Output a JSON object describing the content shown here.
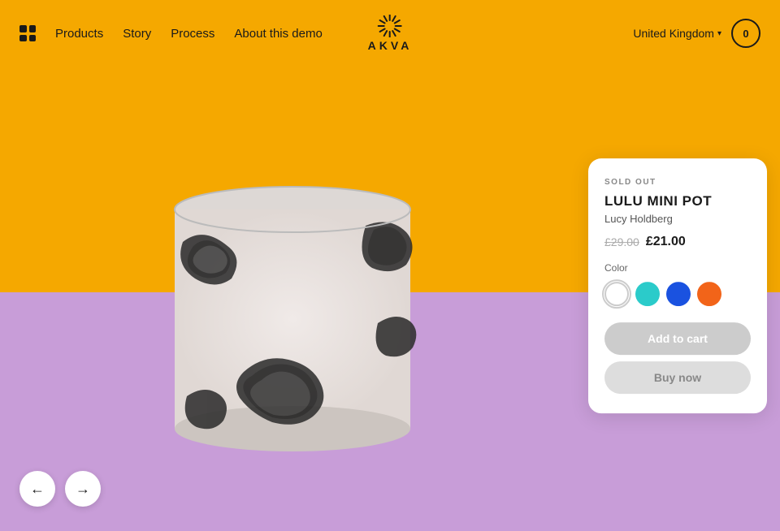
{
  "nav": {
    "products_label": "Products",
    "story_label": "Story",
    "process_label": "Process",
    "about_label": "About this demo",
    "logo_text": "AKVA",
    "region_label": "United Kingdom",
    "cart_count": "0"
  },
  "hero": {
    "top_color": "#F5A800",
    "bottom_color": "#C89DD8"
  },
  "product": {
    "sold_out_label": "SOLD OUT",
    "name": "LULU MINI POT",
    "artist": "Lucy Holdberg",
    "price_old": "£29.00",
    "price_new": "£21.00",
    "color_label": "Color",
    "colors": [
      {
        "name": "white",
        "hex": "#FFFFFF",
        "selected": true
      },
      {
        "name": "teal",
        "hex": "#2BCBCA",
        "selected": false
      },
      {
        "name": "blue",
        "hex": "#1A52E0",
        "selected": false
      },
      {
        "name": "orange",
        "hex": "#F26419",
        "selected": false
      }
    ],
    "add_to_cart_label": "Add to cart",
    "buy_now_label": "Buy now"
  },
  "arrows": {
    "prev_label": "←",
    "next_label": "→"
  }
}
